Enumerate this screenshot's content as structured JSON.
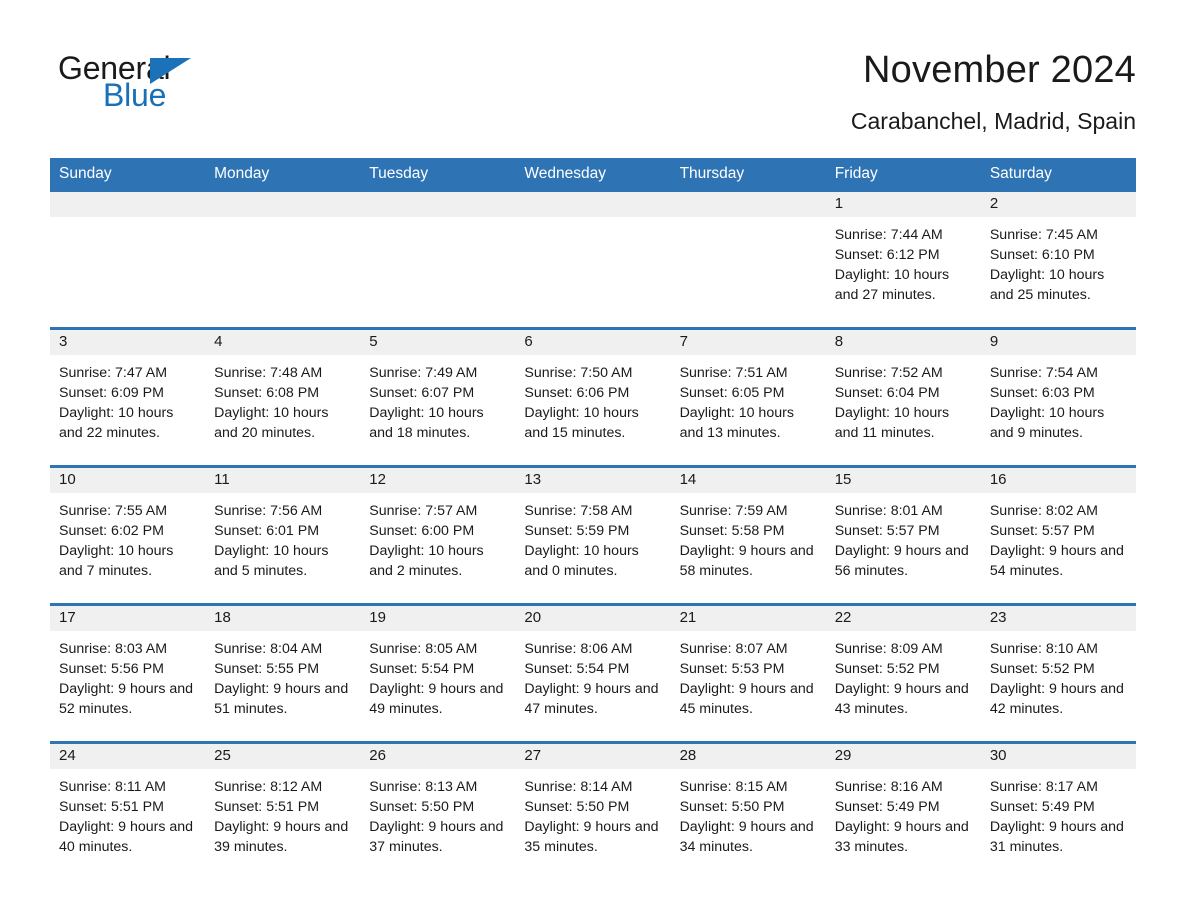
{
  "logo": {
    "word_one": "General",
    "word_two": "Blue",
    "triangle_icon": "triangle-icon",
    "brand_color": "#1870b9"
  },
  "header": {
    "title": "November 2024",
    "subtitle": "Carabanchel, Madrid, Spain"
  },
  "theme": {
    "header_blue": "#2e74b5",
    "row_divider_blue": "#2e74b5",
    "day_strip_gray": "#f0f0f0",
    "text_color": "#1a1a1a",
    "background": "#ffffff"
  },
  "weekday_headers": [
    "Sunday",
    "Monday",
    "Tuesday",
    "Wednesday",
    "Thursday",
    "Friday",
    "Saturday"
  ],
  "weeks": [
    [
      {
        "day": "",
        "sunrise": "",
        "sunset": "",
        "daylight": "",
        "empty": true
      },
      {
        "day": "",
        "sunrise": "",
        "sunset": "",
        "daylight": "",
        "empty": true
      },
      {
        "day": "",
        "sunrise": "",
        "sunset": "",
        "daylight": "",
        "empty": true
      },
      {
        "day": "",
        "sunrise": "",
        "sunset": "",
        "daylight": "",
        "empty": true
      },
      {
        "day": "",
        "sunrise": "",
        "sunset": "",
        "daylight": "",
        "empty": true
      },
      {
        "day": "1",
        "sunrise": "Sunrise: 7:44 AM",
        "sunset": "Sunset: 6:12 PM",
        "daylight": "Daylight: 10 hours and 27 minutes.",
        "empty": false
      },
      {
        "day": "2",
        "sunrise": "Sunrise: 7:45 AM",
        "sunset": "Sunset: 6:10 PM",
        "daylight": "Daylight: 10 hours and 25 minutes.",
        "empty": false
      }
    ],
    [
      {
        "day": "3",
        "sunrise": "Sunrise: 7:47 AM",
        "sunset": "Sunset: 6:09 PM",
        "daylight": "Daylight: 10 hours and 22 minutes.",
        "empty": false
      },
      {
        "day": "4",
        "sunrise": "Sunrise: 7:48 AM",
        "sunset": "Sunset: 6:08 PM",
        "daylight": "Daylight: 10 hours and 20 minutes.",
        "empty": false
      },
      {
        "day": "5",
        "sunrise": "Sunrise: 7:49 AM",
        "sunset": "Sunset: 6:07 PM",
        "daylight": "Daylight: 10 hours and 18 minutes.",
        "empty": false
      },
      {
        "day": "6",
        "sunrise": "Sunrise: 7:50 AM",
        "sunset": "Sunset: 6:06 PM",
        "daylight": "Daylight: 10 hours and 15 minutes.",
        "empty": false
      },
      {
        "day": "7",
        "sunrise": "Sunrise: 7:51 AM",
        "sunset": "Sunset: 6:05 PM",
        "daylight": "Daylight: 10 hours and 13 minutes.",
        "empty": false
      },
      {
        "day": "8",
        "sunrise": "Sunrise: 7:52 AM",
        "sunset": "Sunset: 6:04 PM",
        "daylight": "Daylight: 10 hours and 11 minutes.",
        "empty": false
      },
      {
        "day": "9",
        "sunrise": "Sunrise: 7:54 AM",
        "sunset": "Sunset: 6:03 PM",
        "daylight": "Daylight: 10 hours and 9 minutes.",
        "empty": false
      }
    ],
    [
      {
        "day": "10",
        "sunrise": "Sunrise: 7:55 AM",
        "sunset": "Sunset: 6:02 PM",
        "daylight": "Daylight: 10 hours and 7 minutes.",
        "empty": false
      },
      {
        "day": "11",
        "sunrise": "Sunrise: 7:56 AM",
        "sunset": "Sunset: 6:01 PM",
        "daylight": "Daylight: 10 hours and 5 minutes.",
        "empty": false
      },
      {
        "day": "12",
        "sunrise": "Sunrise: 7:57 AM",
        "sunset": "Sunset: 6:00 PM",
        "daylight": "Daylight: 10 hours and 2 minutes.",
        "empty": false
      },
      {
        "day": "13",
        "sunrise": "Sunrise: 7:58 AM",
        "sunset": "Sunset: 5:59 PM",
        "daylight": "Daylight: 10 hours and 0 minutes.",
        "empty": false
      },
      {
        "day": "14",
        "sunrise": "Sunrise: 7:59 AM",
        "sunset": "Sunset: 5:58 PM",
        "daylight": "Daylight: 9 hours and 58 minutes.",
        "empty": false
      },
      {
        "day": "15",
        "sunrise": "Sunrise: 8:01 AM",
        "sunset": "Sunset: 5:57 PM",
        "daylight": "Daylight: 9 hours and 56 minutes.",
        "empty": false
      },
      {
        "day": "16",
        "sunrise": "Sunrise: 8:02 AM",
        "sunset": "Sunset: 5:57 PM",
        "daylight": "Daylight: 9 hours and 54 minutes.",
        "empty": false
      }
    ],
    [
      {
        "day": "17",
        "sunrise": "Sunrise: 8:03 AM",
        "sunset": "Sunset: 5:56 PM",
        "daylight": "Daylight: 9 hours and 52 minutes.",
        "empty": false
      },
      {
        "day": "18",
        "sunrise": "Sunrise: 8:04 AM",
        "sunset": "Sunset: 5:55 PM",
        "daylight": "Daylight: 9 hours and 51 minutes.",
        "empty": false
      },
      {
        "day": "19",
        "sunrise": "Sunrise: 8:05 AM",
        "sunset": "Sunset: 5:54 PM",
        "daylight": "Daylight: 9 hours and 49 minutes.",
        "empty": false
      },
      {
        "day": "20",
        "sunrise": "Sunrise: 8:06 AM",
        "sunset": "Sunset: 5:54 PM",
        "daylight": "Daylight: 9 hours and 47 minutes.",
        "empty": false
      },
      {
        "day": "21",
        "sunrise": "Sunrise: 8:07 AM",
        "sunset": "Sunset: 5:53 PM",
        "daylight": "Daylight: 9 hours and 45 minutes.",
        "empty": false
      },
      {
        "day": "22",
        "sunrise": "Sunrise: 8:09 AM",
        "sunset": "Sunset: 5:52 PM",
        "daylight": "Daylight: 9 hours and 43 minutes.",
        "empty": false
      },
      {
        "day": "23",
        "sunrise": "Sunrise: 8:10 AM",
        "sunset": "Sunset: 5:52 PM",
        "daylight": "Daylight: 9 hours and 42 minutes.",
        "empty": false
      }
    ],
    [
      {
        "day": "24",
        "sunrise": "Sunrise: 8:11 AM",
        "sunset": "Sunset: 5:51 PM",
        "daylight": "Daylight: 9 hours and 40 minutes.",
        "empty": false
      },
      {
        "day": "25",
        "sunrise": "Sunrise: 8:12 AM",
        "sunset": "Sunset: 5:51 PM",
        "daylight": "Daylight: 9 hours and 39 minutes.",
        "empty": false
      },
      {
        "day": "26",
        "sunrise": "Sunrise: 8:13 AM",
        "sunset": "Sunset: 5:50 PM",
        "daylight": "Daylight: 9 hours and 37 minutes.",
        "empty": false
      },
      {
        "day": "27",
        "sunrise": "Sunrise: 8:14 AM",
        "sunset": "Sunset: 5:50 PM",
        "daylight": "Daylight: 9 hours and 35 minutes.",
        "empty": false
      },
      {
        "day": "28",
        "sunrise": "Sunrise: 8:15 AM",
        "sunset": "Sunset: 5:50 PM",
        "daylight": "Daylight: 9 hours and 34 minutes.",
        "empty": false
      },
      {
        "day": "29",
        "sunrise": "Sunrise: 8:16 AM",
        "sunset": "Sunset: 5:49 PM",
        "daylight": "Daylight: 9 hours and 33 minutes.",
        "empty": false
      },
      {
        "day": "30",
        "sunrise": "Sunrise: 8:17 AM",
        "sunset": "Sunset: 5:49 PM",
        "daylight": "Daylight: 9 hours and 31 minutes.",
        "empty": false
      }
    ]
  ]
}
